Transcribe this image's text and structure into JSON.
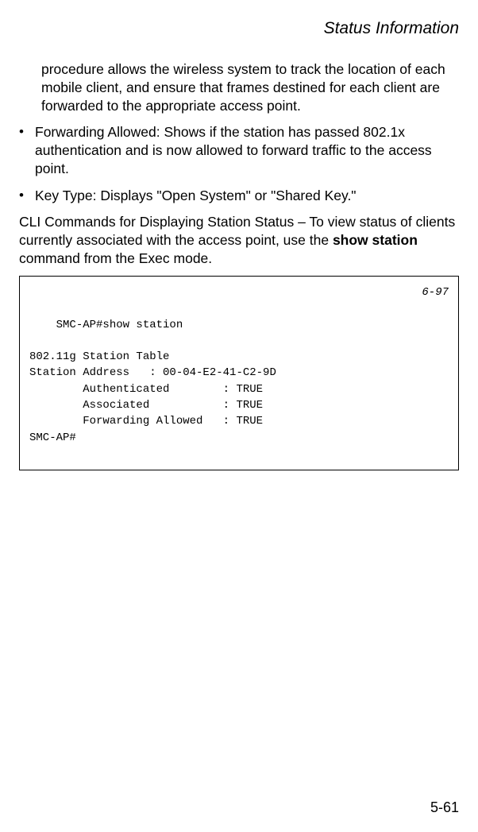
{
  "header": {
    "title": "Status Information"
  },
  "content": {
    "intro_paragraph": "procedure allows the wireless system to track the location of each mobile client, and ensure that frames destined for each client are forwarded to the appropriate access point.",
    "bullets": [
      "Forwarding Allowed: Shows if the station has passed 802.1x authentication and is now allowed to forward traffic to the access point.",
      "Key Type: Displays \"Open System\" or \"Shared Key.\""
    ],
    "cli_paragraph_pre": "CLI Commands for Displaying Station Status – To view status of clients currently associated with the access point, use the ",
    "cli_command": "show station",
    "cli_paragraph_post": " command from the Exec mode."
  },
  "code": {
    "reference": "6-97",
    "lines": "SMC-AP#show station\n\n802.11g Station Table\nStation Address   : 00-04-E2-41-C2-9D\n        Authenticated        : TRUE\n        Associated           : TRUE\n        Forwarding Allowed   : TRUE\nSMC-AP#"
  },
  "footer": {
    "page_number": "5-61"
  }
}
